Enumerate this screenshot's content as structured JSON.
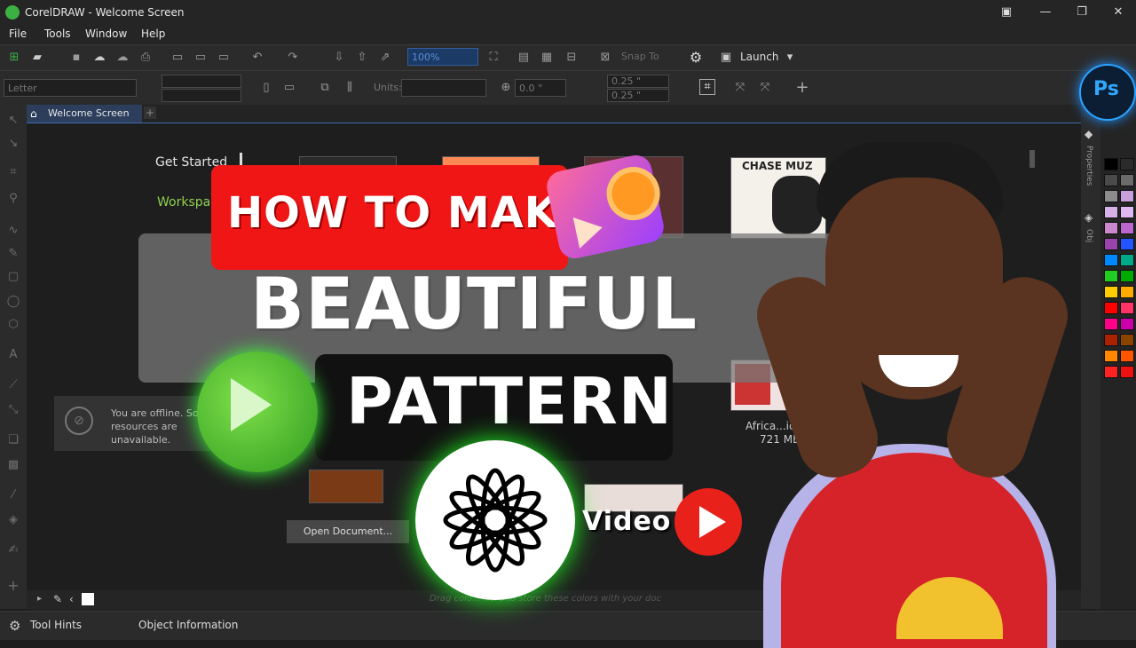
{
  "window": {
    "title": "CorelDRAW - Welcome Screen"
  },
  "menu": [
    "File",
    "Tools",
    "Window",
    "Help"
  ],
  "toolbar": {
    "zoom_value": "100%",
    "snap_to": "Snap To",
    "launch": "Launch",
    "page_size": "Letter",
    "units_label": "Units:",
    "angle": "0.0 °",
    "nudge_x": "0.25 \"",
    "nudge_y": "0.25 \""
  },
  "tab": {
    "label": "Welcome Screen"
  },
  "welcome": {
    "get_started": "Get Started",
    "workspace": "Workspa",
    "offline_text": "You are offline. Sor\nresources are\nunavailable.",
    "open_document": "Open Document...",
    "file_name": "Africa...ics.cdr",
    "file_size": "721 MB",
    "thumb_title": "CHASE MUZ",
    "drag_hint": "Drag colo… here to store these colors with your doc"
  },
  "right_panels": [
    "Properties",
    "Obj"
  ],
  "status": {
    "tool_hints": "Tool Hints",
    "object_info": "Object Information"
  },
  "overlay": {
    "line1": "HOW TO MAKE",
    "line2": "BEAUTIFUL",
    "line3": "PATTERN",
    "video_label": "Video",
    "ps_badge": "Ps"
  },
  "palette_colors": [
    "#000000",
    "#2b2b2b",
    "#4a4a4a",
    "#6b6b6b",
    "#8c8c8c",
    "#c9a0dc",
    "#d8b0e8",
    "#e0b8f0",
    "#cc88cc",
    "#bb66cc",
    "#9944aa",
    "#2255ff",
    "#0088ff",
    "#00aa88",
    "#22cc22",
    "#00aa00",
    "#ffcc00",
    "#ffaa00",
    "#ff0000",
    "#ff3366",
    "#ff0088",
    "#cc00aa",
    "#aa2200",
    "#884400",
    "#ff8800",
    "#ff5500",
    "#ff2222",
    "#ee1111"
  ]
}
